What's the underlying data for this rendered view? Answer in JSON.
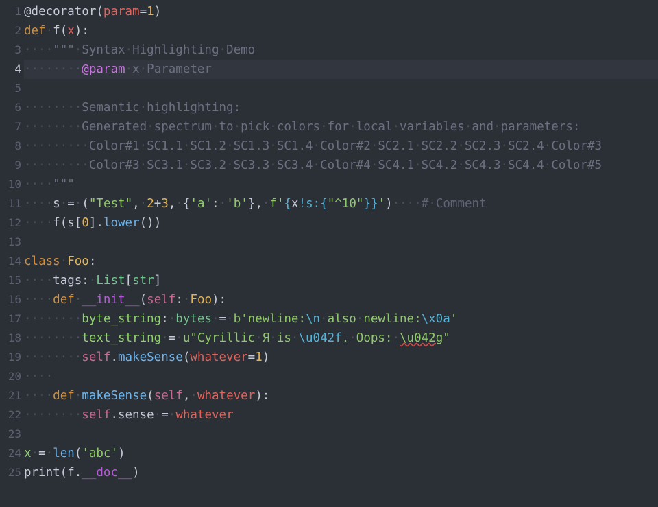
{
  "editor": {
    "current_line": 4,
    "lines": [
      {
        "n": "1",
        "t": [
          [
            "t-plain",
            "@decorator("
          ],
          [
            "t-param",
            "param"
          ],
          [
            "t-plain",
            "="
          ],
          [
            "t-num",
            "1"
          ],
          [
            "t-plain",
            ")"
          ]
        ]
      },
      {
        "n": "2",
        "t": [
          [
            "t-kw",
            "def"
          ],
          [
            "t-ws",
            "·"
          ],
          [
            "t-plain",
            "f("
          ],
          [
            "t-param",
            "x"
          ],
          [
            "t-plain",
            "):"
          ]
        ]
      },
      {
        "n": "3",
        "t": [
          [
            "t-ws",
            "····"
          ],
          [
            "t-doc",
            "\"\"\""
          ],
          [
            "t-ws",
            "·"
          ],
          [
            "t-doc",
            "Syntax"
          ],
          [
            "t-ws",
            "·"
          ],
          [
            "t-doc",
            "Highlighting"
          ],
          [
            "t-ws",
            "·"
          ],
          [
            "t-doc",
            "Demo"
          ]
        ]
      },
      {
        "n": "4",
        "t": [
          [
            "t-ws",
            "········"
          ],
          [
            "t-doctag",
            "@param"
          ],
          [
            "t-ws",
            "·"
          ],
          [
            "t-doc",
            "x"
          ],
          [
            "t-ws",
            "·"
          ],
          [
            "t-doc",
            "Parameter"
          ]
        ]
      },
      {
        "n": "5",
        "t": []
      },
      {
        "n": "6",
        "t": [
          [
            "t-ws",
            "········"
          ],
          [
            "t-doc",
            "Semantic"
          ],
          [
            "t-ws",
            "·"
          ],
          [
            "t-doc",
            "highlighting:"
          ]
        ]
      },
      {
        "n": "7",
        "t": [
          [
            "t-ws",
            "········"
          ],
          [
            "t-doc",
            "Generated"
          ],
          [
            "t-ws",
            "·"
          ],
          [
            "t-doc",
            "spectrum"
          ],
          [
            "t-ws",
            "·"
          ],
          [
            "t-doc",
            "to"
          ],
          [
            "t-ws",
            "·"
          ],
          [
            "t-doc",
            "pick"
          ],
          [
            "t-ws",
            "·"
          ],
          [
            "t-doc",
            "colors"
          ],
          [
            "t-ws",
            "·"
          ],
          [
            "t-doc",
            "for"
          ],
          [
            "t-ws",
            "·"
          ],
          [
            "t-doc",
            "local"
          ],
          [
            "t-ws",
            "·"
          ],
          [
            "t-doc",
            "variables"
          ],
          [
            "t-ws",
            "·"
          ],
          [
            "t-doc",
            "and"
          ],
          [
            "t-ws",
            "·"
          ],
          [
            "t-doc",
            "parameters:"
          ]
        ]
      },
      {
        "n": "8",
        "t": [
          [
            "t-ws",
            "·········"
          ],
          [
            "t-doc",
            "Color#1"
          ],
          [
            "t-ws",
            "·"
          ],
          [
            "t-doc",
            "SC1.1"
          ],
          [
            "t-ws",
            "·"
          ],
          [
            "t-doc",
            "SC1.2"
          ],
          [
            "t-ws",
            "·"
          ],
          [
            "t-doc",
            "SC1.3"
          ],
          [
            "t-ws",
            "·"
          ],
          [
            "t-doc",
            "SC1.4"
          ],
          [
            "t-ws",
            "·"
          ],
          [
            "t-doc",
            "Color#2"
          ],
          [
            "t-ws",
            "·"
          ],
          [
            "t-doc",
            "SC2.1"
          ],
          [
            "t-ws",
            "·"
          ],
          [
            "t-doc",
            "SC2.2"
          ],
          [
            "t-ws",
            "·"
          ],
          [
            "t-doc",
            "SC2.3"
          ],
          [
            "t-ws",
            "·"
          ],
          [
            "t-doc",
            "SC2.4"
          ],
          [
            "t-ws",
            "·"
          ],
          [
            "t-doc",
            "Color#3"
          ]
        ]
      },
      {
        "n": "9",
        "t": [
          [
            "t-ws",
            "·········"
          ],
          [
            "t-doc",
            "Color#3"
          ],
          [
            "t-ws",
            "·"
          ],
          [
            "t-doc",
            "SC3.1"
          ],
          [
            "t-ws",
            "·"
          ],
          [
            "t-doc",
            "SC3.2"
          ],
          [
            "t-ws",
            "·"
          ],
          [
            "t-doc",
            "SC3.3"
          ],
          [
            "t-ws",
            "·"
          ],
          [
            "t-doc",
            "SC3.4"
          ],
          [
            "t-ws",
            "·"
          ],
          [
            "t-doc",
            "Color#4"
          ],
          [
            "t-ws",
            "·"
          ],
          [
            "t-doc",
            "SC4.1"
          ],
          [
            "t-ws",
            "·"
          ],
          [
            "t-doc",
            "SC4.2"
          ],
          [
            "t-ws",
            "·"
          ],
          [
            "t-doc",
            "SC4.3"
          ],
          [
            "t-ws",
            "·"
          ],
          [
            "t-doc",
            "SC4.4"
          ],
          [
            "t-ws",
            "·"
          ],
          [
            "t-doc",
            "Color#5"
          ]
        ]
      },
      {
        "n": "10",
        "t": [
          [
            "t-ws",
            "····"
          ],
          [
            "t-doc",
            "\"\"\""
          ]
        ]
      },
      {
        "n": "11",
        "t": [
          [
            "t-ws",
            "····"
          ],
          [
            "t-plain",
            "s"
          ],
          [
            "t-ws",
            "·"
          ],
          [
            "t-plain",
            "="
          ],
          [
            "t-ws",
            "·"
          ],
          [
            "t-plain",
            "("
          ],
          [
            "t-str",
            "\"Test\""
          ],
          [
            "t-plain",
            ","
          ],
          [
            "t-ws",
            "·"
          ],
          [
            "t-num",
            "2"
          ],
          [
            "t-plain",
            "+"
          ],
          [
            "t-num",
            "3"
          ],
          [
            "t-plain",
            ","
          ],
          [
            "t-ws",
            "·"
          ],
          [
            "t-plain",
            "{"
          ],
          [
            "t-str",
            "'a'"
          ],
          [
            "t-plain",
            ":"
          ],
          [
            "t-ws",
            "·"
          ],
          [
            "t-str",
            "'b'"
          ],
          [
            "t-plain",
            "},"
          ],
          [
            "t-ws",
            "·"
          ],
          [
            "t-str",
            "f'"
          ],
          [
            "t-fmt",
            "{"
          ],
          [
            "t-plain",
            "x"
          ],
          [
            "t-fmt",
            "!s:{"
          ],
          [
            "t-str",
            "\"^10\""
          ],
          [
            "t-fmt",
            "}}"
          ],
          [
            "t-str",
            "'"
          ],
          [
            "t-plain",
            ")"
          ],
          [
            "t-ws",
            "····"
          ],
          [
            "t-comment",
            "#"
          ],
          [
            "t-ws",
            "·"
          ],
          [
            "t-comment",
            "Comment"
          ]
        ]
      },
      {
        "n": "12",
        "t": [
          [
            "t-ws",
            "····"
          ],
          [
            "t-plain",
            "f(s["
          ],
          [
            "t-num",
            "0"
          ],
          [
            "t-plain",
            "]."
          ],
          [
            "t-call",
            "lower"
          ],
          [
            "t-plain",
            "())"
          ]
        ]
      },
      {
        "n": "13",
        "t": []
      },
      {
        "n": "14",
        "t": [
          [
            "t-kw",
            "class"
          ],
          [
            "t-ws",
            "·"
          ],
          [
            "t-cls",
            "Foo"
          ],
          [
            "t-plain",
            ":"
          ]
        ]
      },
      {
        "n": "15",
        "t": [
          [
            "t-ws",
            "····"
          ],
          [
            "t-plain",
            "tags:"
          ],
          [
            "t-ws",
            "·"
          ],
          [
            "t-type",
            "List"
          ],
          [
            "t-plain",
            "["
          ],
          [
            "t-type",
            "str"
          ],
          [
            "t-plain",
            "]"
          ]
        ]
      },
      {
        "n": "16",
        "t": [
          [
            "t-ws",
            "····"
          ],
          [
            "t-kw",
            "def"
          ],
          [
            "t-ws",
            "·"
          ],
          [
            "t-dunder",
            "__init__"
          ],
          [
            "t-plain",
            "("
          ],
          [
            "t-self",
            "self"
          ],
          [
            "t-plain",
            ":"
          ],
          [
            "t-ws",
            "·"
          ],
          [
            "t-cls",
            "Foo"
          ],
          [
            "t-plain",
            "):"
          ]
        ]
      },
      {
        "n": "17",
        "t": [
          [
            "t-ws",
            "········"
          ],
          [
            "t-builtin",
            "byte_string"
          ],
          [
            "t-plain",
            ":"
          ],
          [
            "t-ws",
            "·"
          ],
          [
            "t-type",
            "bytes"
          ],
          [
            "t-ws",
            "·"
          ],
          [
            "t-plain",
            "="
          ],
          [
            "t-ws",
            "·"
          ],
          [
            "t-str",
            "b'newline:"
          ],
          [
            "t-esc",
            "\\n"
          ],
          [
            "t-ws",
            "·"
          ],
          [
            "t-str",
            "also"
          ],
          [
            "t-ws",
            "·"
          ],
          [
            "t-str",
            "newline:"
          ],
          [
            "t-esc",
            "\\x0a"
          ],
          [
            "t-str",
            "'"
          ]
        ]
      },
      {
        "n": "18",
        "t": [
          [
            "t-ws",
            "········"
          ],
          [
            "t-builtin",
            "text_string"
          ],
          [
            "t-ws",
            "·"
          ],
          [
            "t-plain",
            "="
          ],
          [
            "t-ws",
            "·"
          ],
          [
            "t-str",
            "u\"Cyrillic"
          ],
          [
            "t-ws",
            "·"
          ],
          [
            "t-str",
            "Я"
          ],
          [
            "t-ws",
            "·"
          ],
          [
            "t-str",
            "is"
          ],
          [
            "t-ws",
            "·"
          ],
          [
            "t-esc",
            "\\u042f"
          ],
          [
            "t-str",
            "."
          ],
          [
            "t-ws",
            "·"
          ],
          [
            "t-str",
            "Oops:"
          ],
          [
            "t-ws",
            "·"
          ],
          [
            "t-err",
            "\\u042g"
          ],
          [
            "t-str",
            "\""
          ]
        ]
      },
      {
        "n": "19",
        "t": [
          [
            "t-ws",
            "········"
          ],
          [
            "t-self",
            "self"
          ],
          [
            "t-plain",
            "."
          ],
          [
            "t-call",
            "makeSense"
          ],
          [
            "t-plain",
            "("
          ],
          [
            "t-param",
            "whatever"
          ],
          [
            "t-plain",
            "="
          ],
          [
            "t-num",
            "1"
          ],
          [
            "t-plain",
            ")"
          ]
        ]
      },
      {
        "n": "20",
        "t": [
          [
            "t-ws",
            "····"
          ]
        ]
      },
      {
        "n": "21",
        "t": [
          [
            "t-ws",
            "····"
          ],
          [
            "t-kw",
            "def"
          ],
          [
            "t-ws",
            "·"
          ],
          [
            "t-fn",
            "makeSense"
          ],
          [
            "t-plain",
            "("
          ],
          [
            "t-self",
            "self"
          ],
          [
            "t-plain",
            ","
          ],
          [
            "t-ws",
            "·"
          ],
          [
            "t-param",
            "whatever"
          ],
          [
            "t-plain",
            "):"
          ]
        ]
      },
      {
        "n": "22",
        "t": [
          [
            "t-ws",
            "········"
          ],
          [
            "t-self",
            "self"
          ],
          [
            "t-plain",
            ".sense"
          ],
          [
            "t-ws",
            "·"
          ],
          [
            "t-plain",
            "="
          ],
          [
            "t-ws",
            "·"
          ],
          [
            "t-param",
            "whatever"
          ]
        ]
      },
      {
        "n": "23",
        "t": []
      },
      {
        "n": "24",
        "t": [
          [
            "t-builtin",
            "x"
          ],
          [
            "t-ws",
            "·"
          ],
          [
            "t-plain",
            "="
          ],
          [
            "t-ws",
            "·"
          ],
          [
            "t-call",
            "len"
          ],
          [
            "t-plain",
            "("
          ],
          [
            "t-str",
            "'abc'"
          ],
          [
            "t-plain",
            ")"
          ]
        ]
      },
      {
        "n": "25",
        "t": [
          [
            "t-plain",
            "print(f."
          ],
          [
            "t-dunder",
            "__doc__"
          ],
          [
            "t-plain",
            ")"
          ]
        ]
      }
    ]
  }
}
